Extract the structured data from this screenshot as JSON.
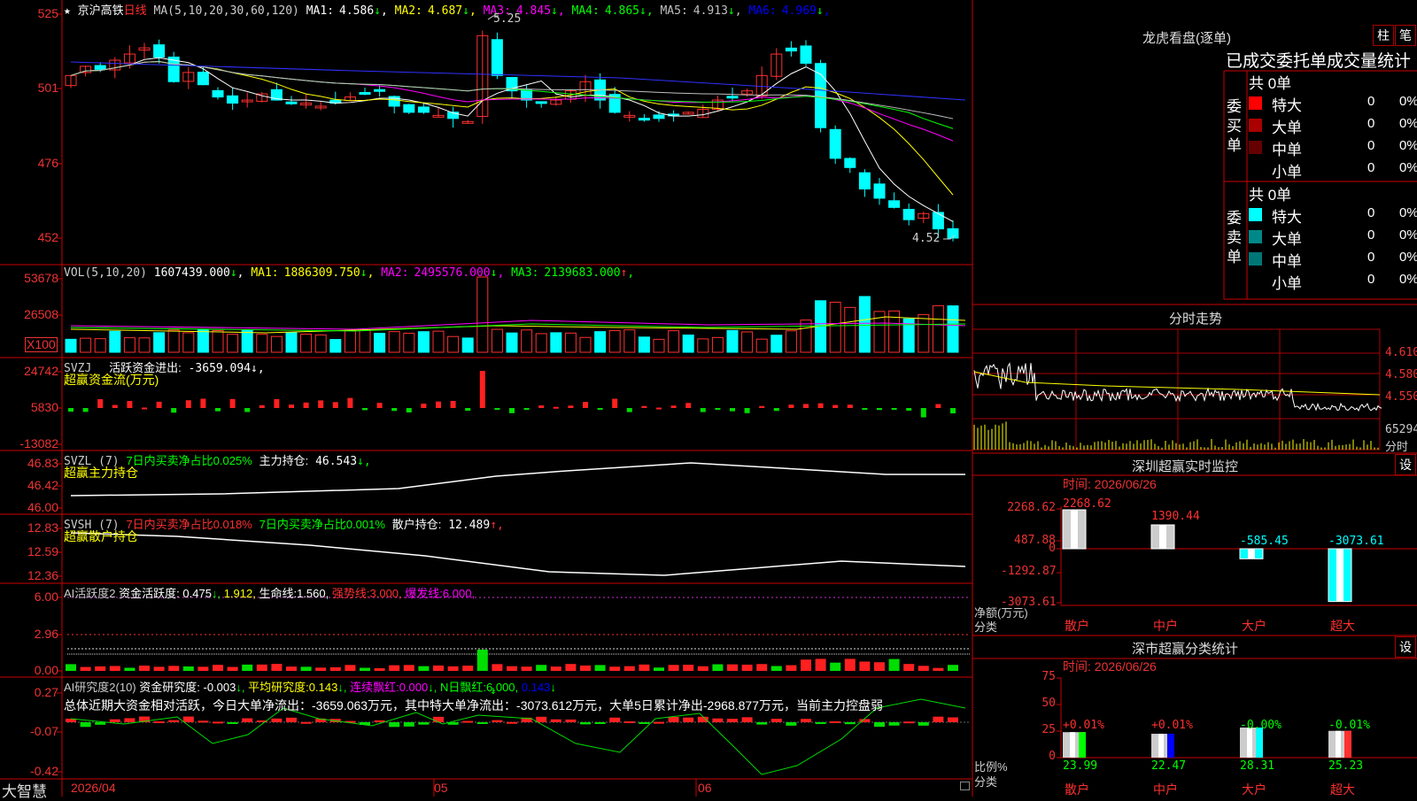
{
  "stock": {
    "name": "京沪高铁",
    "period": "日线"
  },
  "k": {
    "ma_label": "MA(5,10,20,30,60,120)",
    "mas": [
      {
        "label": "MA1:",
        "value": "4.586",
        "arrow": "↓",
        "color": "#ffffff"
      },
      {
        "label": "MA2:",
        "value": "4.687",
        "arrow": "↓",
        "color": "#ffff00"
      },
      {
        "label": "MA3:",
        "value": "4.845",
        "arrow": "↓",
        "color": "#ff00ff"
      },
      {
        "label": "MA4:",
        "value": "4.865",
        "arrow": "↓",
        "color": "#00ff00"
      },
      {
        "label": "MA5:",
        "value": "4.913",
        "arrow": "↓",
        "color": "#c0c0c0"
      },
      {
        "label": "MA6:",
        "value": "4.969",
        "arrow": "↓",
        "color": "#0000ff"
      }
    ],
    "ticks": [
      "525",
      "501",
      "476",
      "452"
    ],
    "high_label": "5.25",
    "low_label": "4.52"
  },
  "vol": {
    "title": "VOL(5,10,20)",
    "value": "1607439.000",
    "arrow": "↓",
    "mas": [
      {
        "label": "MA1:",
        "value": "1886309.750",
        "arrow": "↓",
        "color": "#ffff00"
      },
      {
        "label": "MA2:",
        "value": "2495576.000",
        "arrow": "↓",
        "color": "#ff00ff"
      },
      {
        "label": "MA3:",
        "value": "2139683.000",
        "arrow": "↑",
        "color": "#00ff00"
      }
    ],
    "ticks": [
      "53678",
      "26508"
    ],
    "unit": "X100"
  },
  "svzj": {
    "title": "SVZJ",
    "label": "活跃资金进出:",
    "value": "-3659.094",
    "arrow": "↓,",
    "sub": "超赢资金流(万元)",
    "ticks": [
      "24742",
      "5830",
      "-13082"
    ]
  },
  "svzl": {
    "title": "SVZL (7)",
    "t1": "7日内买卖净占比0.025%",
    "label": "主力持仓:",
    "value": "46.543",
    "arrow": "↓,",
    "sub": "超赢主力持仓",
    "ticks": [
      "46.83",
      "46.42",
      "46.00"
    ]
  },
  "svsh": {
    "title": "SVSH (7)",
    "t1": "7日内买卖净占比0.018%",
    "t2": "7日内买卖净占比0.001%",
    "label": "散户持仓:",
    "value": "12.489",
    "arrow": "↑,",
    "sub": "超赢散户持仓",
    "ticks": [
      "12.83",
      "12.59",
      "12.36"
    ]
  },
  "ai1": {
    "title": "AI活跃度2",
    "label": "资金活跃度:",
    "v1": "0.475",
    "a1": "↓,",
    "v2": "1.912,",
    "life": "生命线:",
    "life_v": "1.560,",
    "strong": "强势线:",
    "strong_v": "3.000,",
    "burst": "爆发线:",
    "burst_v": "6.000,",
    "ticks": [
      "6.00",
      "2.96",
      "0.00"
    ]
  },
  "ai2": {
    "title": "AI研究度2(10)",
    "label": "资金研究度:",
    "v1": "-0.003",
    "a1": "↓,",
    "avg": "平均研究度:",
    "avg_v": "0.143",
    "avg_a": "↓,",
    "cont": "连续飘红:",
    "cont_v": "0.000",
    "cont_a": "↓,",
    "nday": "N日飘红:",
    "nday_v": "6.000,",
    "last": "0.143",
    "last_a": "↓",
    "summary": "总体近期大资金相对活跃，今日大单净流出：-3659.063万元，其中特大单净流出：-3073.612万元，大单5日累计净出-2968.877万元，当前主力控盘弱",
    "ticks": [
      "0.27",
      "-0.07",
      "-0.42"
    ]
  },
  "bottom": {
    "logo": "大智慧",
    "dates": [
      "2026/04",
      "05",
      "06"
    ]
  },
  "lhb": {
    "title": "龙虎看盘(逐单)",
    "btn_bar": "柱",
    "btn_pen": "笔",
    "tabs_title": "已成交委托单成交量统计",
    "buy": {
      "label": "委买单",
      "total": "共 0单",
      "rows": [
        {
          "name": "特大",
          "count": "0",
          "pct": "0%",
          "color": "#ff0000"
        },
        {
          "name": "大单",
          "count": "0",
          "pct": "0%",
          "color": "#aa0000"
        },
        {
          "name": "中单",
          "count": "0",
          "pct": "0%",
          "color": "#660000"
        },
        {
          "name": "小单",
          "count": "0",
          "pct": "0%",
          "color": ""
        }
      ]
    },
    "sell": {
      "label": "委卖单",
      "total": "共 0单",
      "rows": [
        {
          "name": "特大",
          "count": "0",
          "pct": "0%",
          "color": "#00ffff"
        },
        {
          "name": "大单",
          "count": "0",
          "pct": "0%",
          "color": "#008888"
        },
        {
          "name": "中单",
          "count": "0",
          "pct": "0%",
          "color": "#007777"
        },
        {
          "name": "小单",
          "count": "0",
          "pct": "0%",
          "color": ""
        }
      ]
    }
  },
  "intraday": {
    "title": "分时走势",
    "prices": [
      "4.610",
      "4.580",
      "4.550"
    ],
    "vol": "65294",
    "fenshi": "分时"
  },
  "monitor": {
    "title": "深圳超赢实时监控",
    "btn": "设",
    "time": "时间: 2026/06/26",
    "ticks": [
      "2268.62",
      "487.88",
      "0",
      "-1292.87",
      "-3073.61"
    ],
    "net_label": "净额(万元)",
    "cat_label": "分类",
    "bars": [
      {
        "name": "散户",
        "value": "2268.62",
        "color": "#ff4040"
      },
      {
        "name": "中户",
        "value": "1390.44",
        "color": "#ff4040"
      },
      {
        "name": "大户",
        "value": "-585.45",
        "color": "#00ffff"
      },
      {
        "name": "超大",
        "value": "-3073.61",
        "color": "#00ffff"
      }
    ]
  },
  "classify": {
    "title": "深市超赢分类统计",
    "btn": "设",
    "time": "时间: 2026/06/26",
    "ticks": [
      "75",
      "50",
      "25",
      "0"
    ],
    "ratio_label": "比例%",
    "cat_label": "分类",
    "bars": [
      {
        "name": "散户",
        "value": "23.99",
        "change": "+0.01%",
        "color": "#00ff00"
      },
      {
        "name": "中户",
        "value": "22.47",
        "change": "+0.01%",
        "color": "#0000ff"
      },
      {
        "name": "大户",
        "value": "28.31",
        "change": "-0.00%",
        "color": "#00ffff"
      },
      {
        "name": "超大",
        "value": "25.23",
        "change": "-0.01%",
        "color": "#ff3030"
      }
    ]
  }
}
